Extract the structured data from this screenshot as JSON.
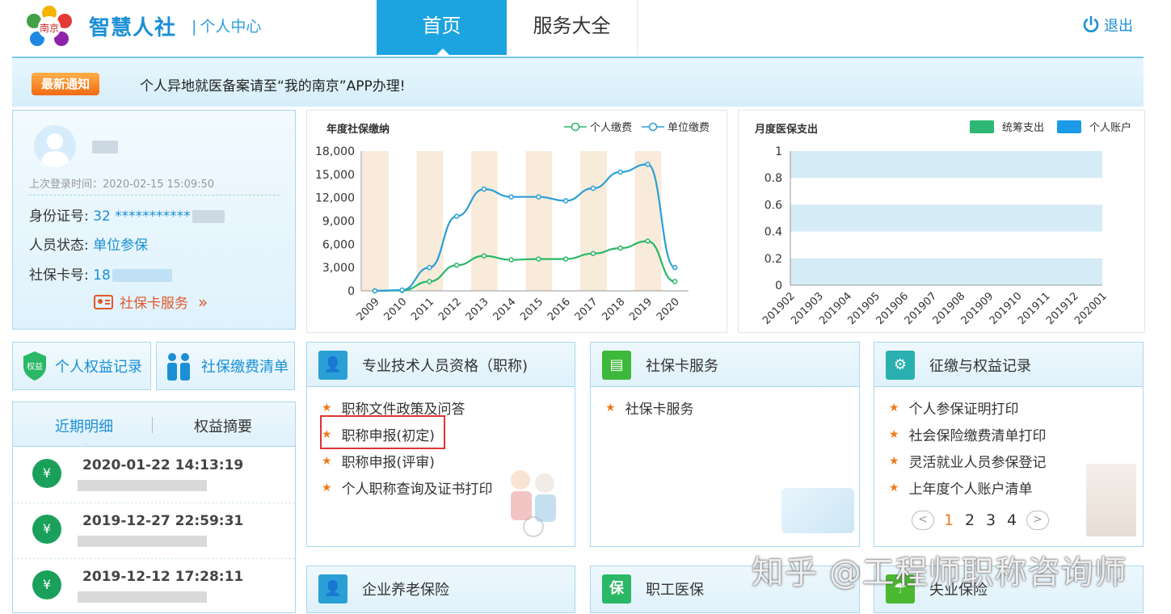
{
  "header": {
    "brand": "智慧人社",
    "sub_brand": "个人中心",
    "nav": [
      "首页",
      "服务大全"
    ],
    "logout": "退出"
  },
  "notice": {
    "badge": "最新通知",
    "text": "个人异地就医备案请至“我的南京”APP办理!"
  },
  "profile": {
    "last_login": "上次登录时间：2020-02-15 15:09:50",
    "id_label": "身份证号:",
    "id_value": "32 ***********",
    "status_label": "人员状态:",
    "status_value": "单位参保",
    "card_label": "社保卡号:",
    "card_value": "18",
    "card_service": "社保卡服务"
  },
  "quick": {
    "rights": "个人权益记录",
    "payments": "社保缴费清单",
    "rights_badge": "权益"
  },
  "recent": {
    "tabs": [
      "近期明细",
      "权益摘要"
    ],
    "items": [
      "2020-01-22 14:13:19",
      "2019-12-27 22:59:31",
      "2019-12-12 17:28:11"
    ]
  },
  "chart_data": [
    {
      "type": "line",
      "title": "年度社保缴纳",
      "categories": [
        "2009",
        "2010",
        "2011",
        "2012",
        "2013",
        "2014",
        "2015",
        "2016",
        "2017",
        "2018",
        "2019",
        "2020"
      ],
      "series": [
        {
          "name": "个人缴费",
          "color": "#2ab866",
          "values": [
            0,
            50,
            1200,
            3300,
            4500,
            4000,
            4100,
            4100,
            4800,
            5500,
            6400,
            1200
          ]
        },
        {
          "name": "单位缴费",
          "color": "#2a9fd6",
          "values": [
            0,
            100,
            3000,
            9600,
            13100,
            12100,
            12100,
            11600,
            13200,
            15300,
            16300,
            3000
          ]
        }
      ],
      "yticks": [
        "0",
        "3,000",
        "6,000",
        "9,000",
        "12,000",
        "15,000",
        "18,000"
      ],
      "ylim": [
        0,
        18000
      ]
    },
    {
      "type": "bar",
      "title": "月度医保支出",
      "categories": [
        "201902",
        "201903",
        "201904",
        "201905",
        "201906",
        "201907",
        "201908",
        "201909",
        "201910",
        "201911",
        "201912",
        "202001"
      ],
      "series": [
        {
          "name": "统筹支出",
          "color": "#2fb873",
          "values": [
            0,
            0,
            0,
            0,
            0,
            0,
            0,
            0,
            0,
            0,
            0,
            0
          ]
        },
        {
          "name": "个人账户",
          "color": "#1b9ae8",
          "values": [
            0,
            0,
            0,
            0,
            0,
            0,
            0,
            0,
            0,
            0,
            0,
            0
          ]
        }
      ],
      "yticks": [
        "0",
        "0.2",
        "0.4",
        "0.6",
        "0.8",
        "1"
      ],
      "ylim": [
        0,
        1
      ]
    }
  ],
  "services": {
    "s1": {
      "title": "专业技术人员资格（职称)",
      "items": [
        "职称文件政策及问答",
        "职称申报(初定)",
        "职称申报(评审)",
        "个人职称查询及证书打印"
      ]
    },
    "s2": {
      "title": "社保卡服务",
      "items": [
        "社保卡服务"
      ]
    },
    "s3": {
      "title": "征缴与权益记录",
      "items": [
        "个人参保证明打印",
        "社会保险缴费清单打印",
        "灵活就业人员参保登记",
        "上年度个人账户清单"
      ]
    },
    "s4": {
      "title": "企业养老保险"
    },
    "s5": {
      "title": "职工医保",
      "icon_text": "保"
    },
    "s6": {
      "title": "失业保险"
    }
  },
  "pager": {
    "prev": "<",
    "next": ">",
    "pages": [
      "1",
      "2",
      "3",
      "4"
    ]
  },
  "watermark": "知乎 @工程师职称咨询师"
}
